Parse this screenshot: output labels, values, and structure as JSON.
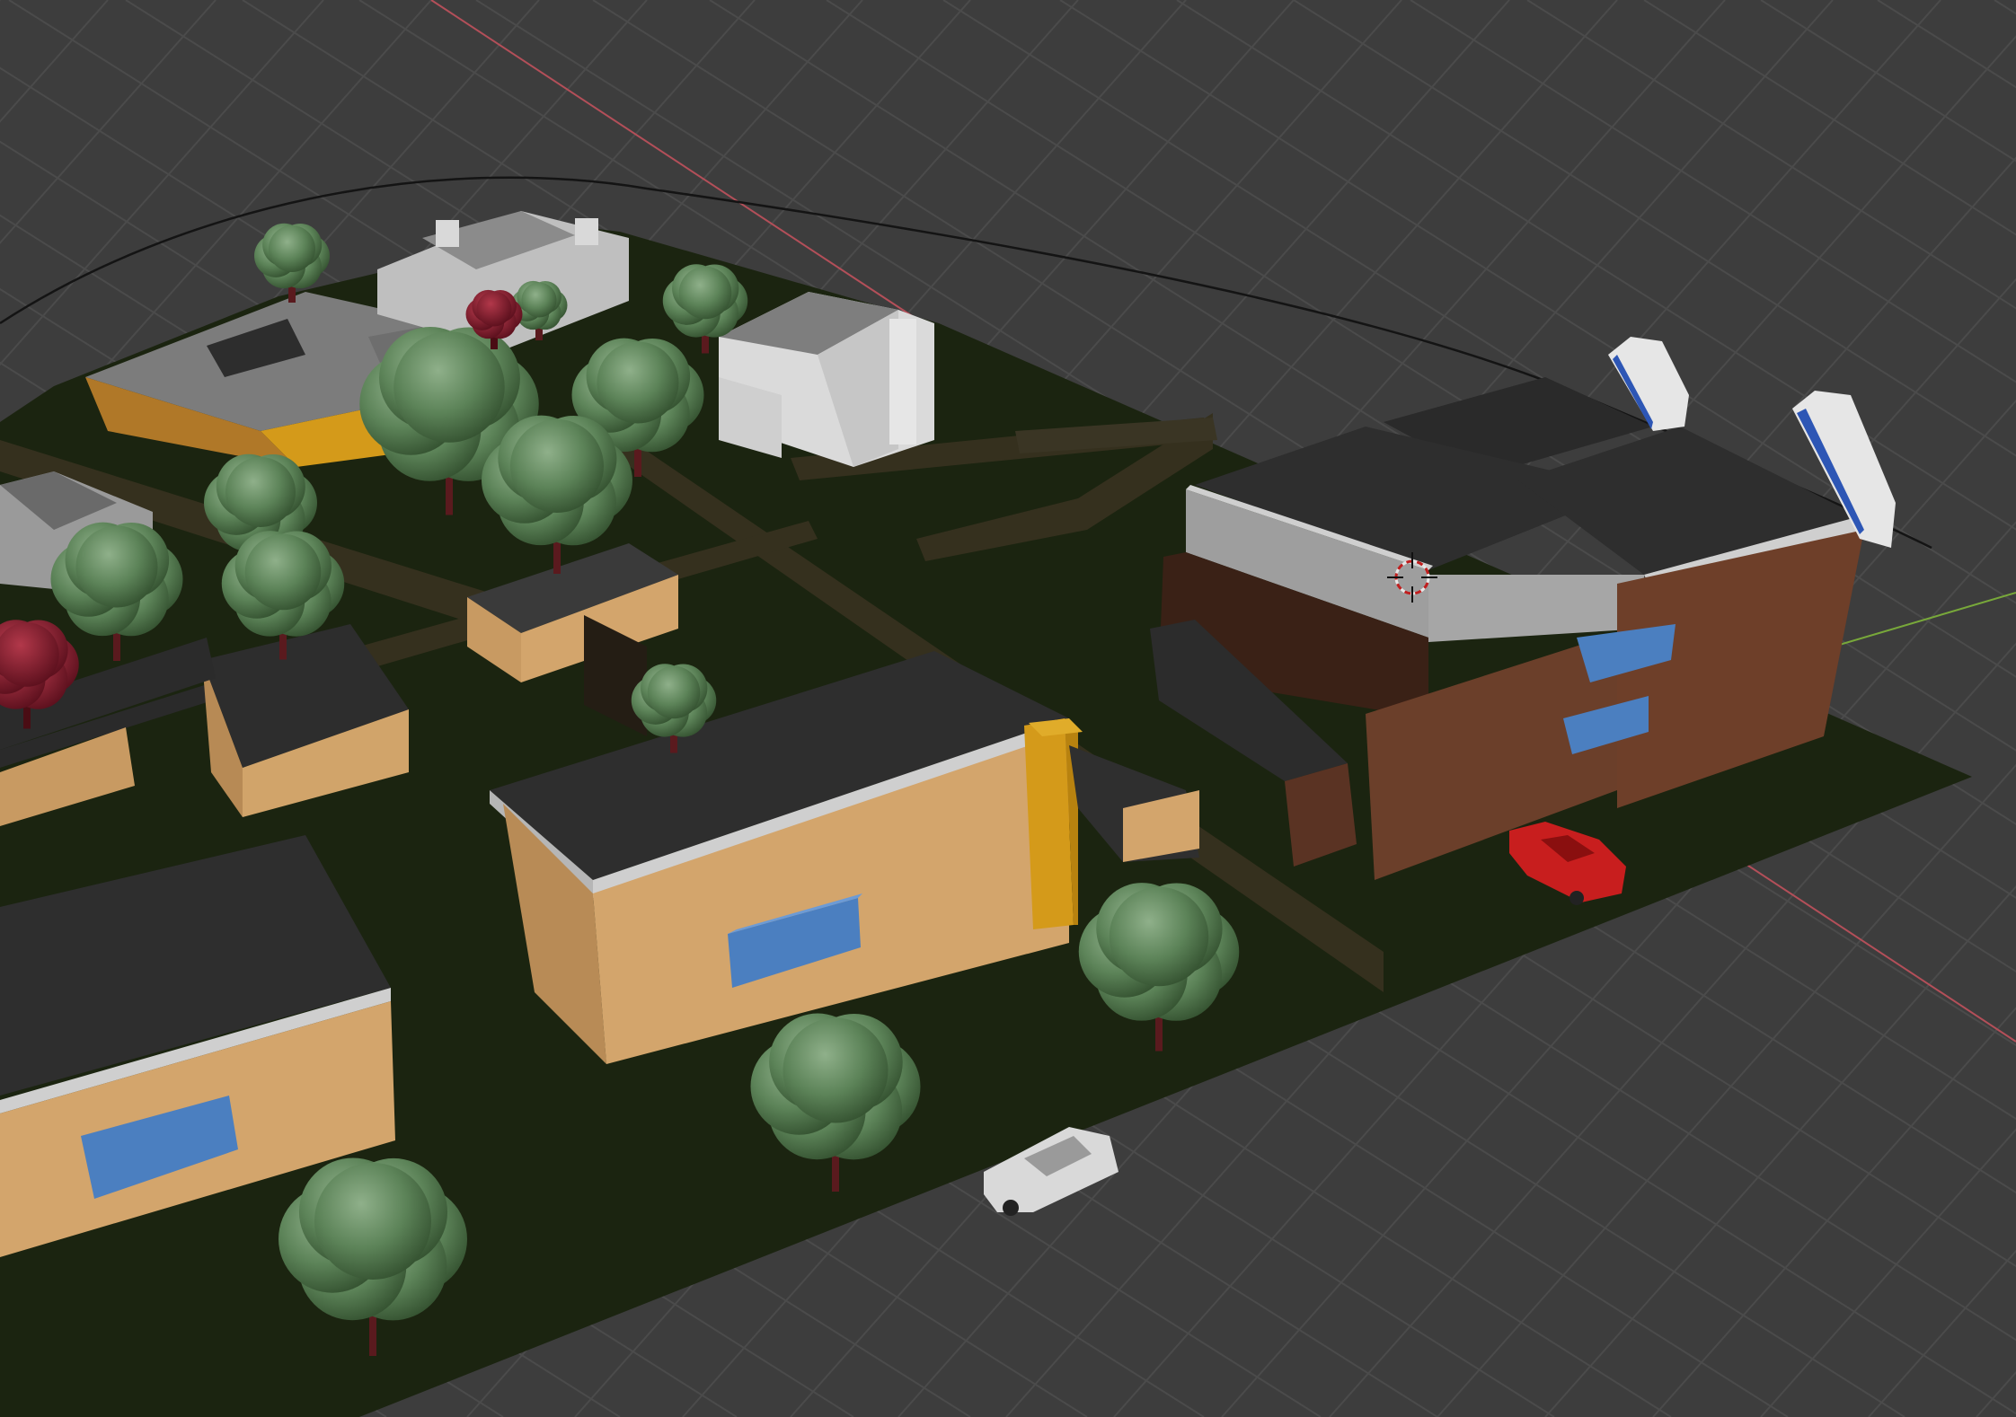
{
  "viewport": {
    "name": "3D Viewport",
    "colors": {
      "background": "#3d3d3d",
      "grid": "#4a4a4a",
      "axis_x": "#c0505a",
      "axis_y": "#7fb23a",
      "ground": "#1b2410",
      "roof": "#2d2d2d",
      "parapet": "#b5b5b5",
      "wall_tan": "#c89a62",
      "wall_brown": "#6b3f2a",
      "window_blue": "#4b7fc0",
      "accent_yellow": "#d8a019",
      "tree_green": "#557d52",
      "tree_red": "#7d1a2a",
      "car_red": "#c81e1e",
      "car_white": "#dcdcdc"
    }
  }
}
